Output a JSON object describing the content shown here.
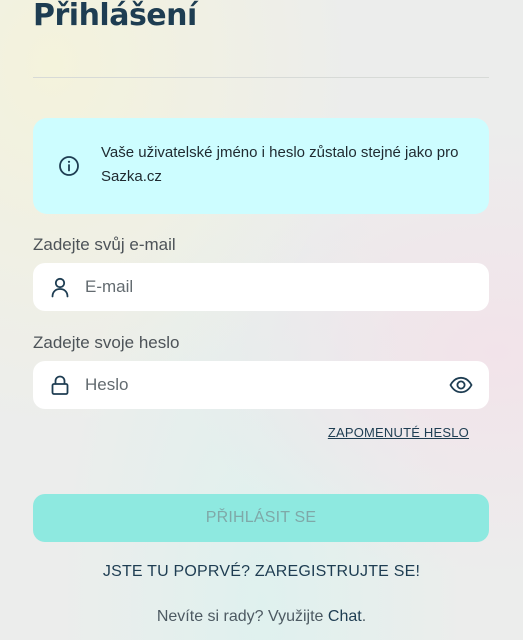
{
  "page": {
    "title": "Přihlášení"
  },
  "info": {
    "icon": "info-icon",
    "text": "Vaše uživatelské jméno i heslo zůstalo stejné jako pro Sazka.cz"
  },
  "email": {
    "label": "Zadejte svůj e-mail",
    "placeholder": "E-mail",
    "icon": "user-icon"
  },
  "password": {
    "label": "Zadejte svoje heslo",
    "placeholder": "Heslo",
    "icon": "lock-icon",
    "toggle_icon": "eye-icon"
  },
  "forgot_label": "ZAPOMENUTÉ HESLO",
  "login_label": "PŘIHLÁSIT SE",
  "register": {
    "prompt": "JSTE TU POPRVÉ?",
    "link": "ZAREGISTRUJTE SE!"
  },
  "help": {
    "prompt": "Nevíte si rady? Využijte",
    "link": "Chat",
    "suffix": "."
  },
  "colors": {
    "brand": "#1e3d52",
    "info_bg": "#cdfdff",
    "button_bg": "#8ee9e0"
  }
}
